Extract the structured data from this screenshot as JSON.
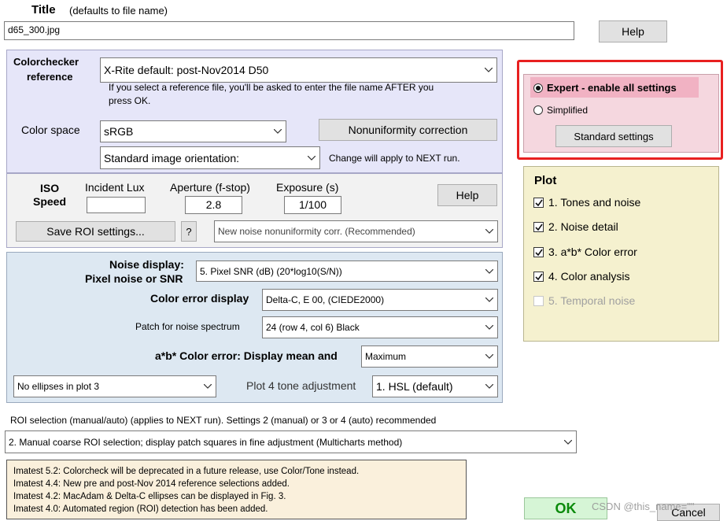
{
  "title_section": {
    "title_label": "Title",
    "title_hint": "(defaults to file name)",
    "title_value": "d65_300.jpg",
    "help_label": "Help"
  },
  "reference": {
    "label_line1": "Colorchecker",
    "label_line2": "reference",
    "selected": "X-Rite default:  post-Nov2014  D50",
    "note_line1": "If you select a reference file, you'll be asked to enter the file name AFTER you",
    "note_line2": "press OK.",
    "color_space_label": "Color space",
    "color_space_value": "sRGB",
    "nonuniformity_button": "Nonuniformity correction",
    "orientation_value": "Standard image orientation:",
    "orientation_note": "Change will apply to NEXT run."
  },
  "exposure": {
    "iso_label_line1": "ISO",
    "iso_label_line2": "Speed",
    "iso_value": "",
    "incident_lux_label": "Incident Lux",
    "aperture_label": "Aperture (f-stop)",
    "aperture_value": "2.8",
    "exposure_label": "Exposure (s)",
    "exposure_value": "1/100",
    "help_label": "Help",
    "save_roi_label": "Save ROI settings...",
    "question_label": "?",
    "noise_corr_value": "New noise nonuniformity corr. (Recommended)"
  },
  "display": {
    "noise_display_label_line1": "Noise display:",
    "noise_display_label_line2": "Pixel noise or SNR",
    "noise_display_value": "5. Pixel SNR (dB)  (20*log10(S/N))",
    "color_error_label": "Color error display",
    "color_error_value": "Delta-C, E 00, (CIEDE2000)",
    "patch_label": "Patch for noise spectrum",
    "patch_value": "24  (row 4, col 6)  Black",
    "ab_error_label": "a*b* Color error: Display mean and",
    "ab_error_value": "Maximum",
    "ellipses_value": "No ellipses in plot 3",
    "plot4_label": "Plot 4 tone adjustment",
    "plot4_value": "1. HSL (default)"
  },
  "roi": {
    "label": "ROI selection (manual/auto) (applies to NEXT run). Settings 2 (manual) or 3 or 4 (auto) recommended",
    "value": "2. Manual coarse ROI selection; display patch squares in fine adjustment (Multicharts method)"
  },
  "notes": [
    "Imatest 5.2:  Colorcheck will be deprecated in a future release, use Color/Tone instead.",
    "Imatest 4.4:  New pre and post-Nov 2014 reference selections added.",
    "Imatest 4.2:  MacAdam & Delta-C ellipses can be displayed in Fig. 3.",
    "Imatest 4.0:  Automated region (ROI) detection has been added."
  ],
  "mode": {
    "expert_label": "Expert - enable all settings",
    "simplified_label": "Simplified",
    "standard_settings_label": "Standard settings",
    "selected": "expert"
  },
  "plot": {
    "heading": "Plot",
    "items": [
      {
        "label": "1. Tones and noise",
        "checked": true,
        "enabled": true
      },
      {
        "label": "2. Noise detail",
        "checked": true,
        "enabled": true
      },
      {
        "label": "3. a*b* Color error",
        "checked": true,
        "enabled": true
      },
      {
        "label": "4. Color analysis",
        "checked": true,
        "enabled": true
      },
      {
        "label": "5. Temporal noise",
        "checked": false,
        "enabled": false
      }
    ]
  },
  "footer": {
    "ok_label": "OK",
    "cancel_label": "Cancel",
    "watermark": "CSDN @this_name=\"\""
  },
  "colors": {
    "reference_panel_bg": "#e6e6f9",
    "exposure_panel_bg": "#f2f2f2",
    "display_panel_bg": "#dde8f2",
    "mode_panel_bg": "#f5d7df",
    "mode_highlight": "#f1b2c3",
    "plot_panel_bg": "#f5f1cf",
    "notes_bg": "#faf0dc",
    "ok_bg": "#d6f5d6",
    "highlight_border": "#e82020",
    "ok_text": "#0a8a0a"
  }
}
